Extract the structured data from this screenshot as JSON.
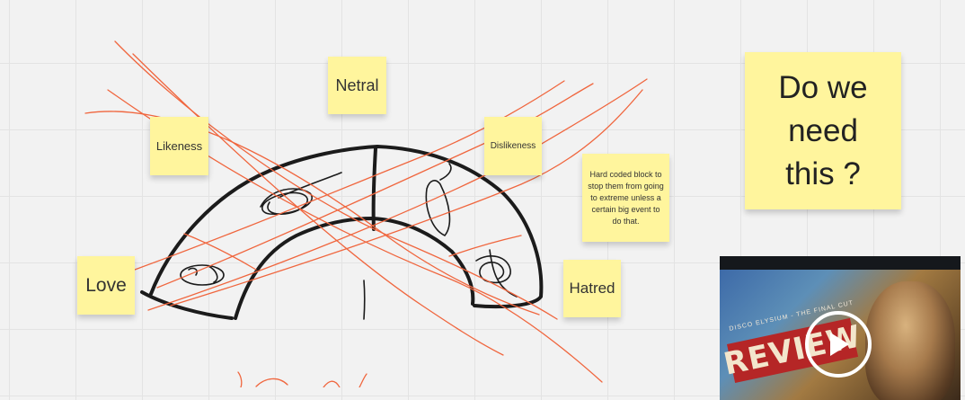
{
  "stickies": {
    "netral": "Netral",
    "likeness": "Likeness",
    "dislikeness": "Dislikeness",
    "love": "Love",
    "hatred": "Hatred",
    "hard_coded": "Hard coded block to stop them from going to extreme unless a certain big event to do that.",
    "question": "Do we need this ?"
  },
  "video": {
    "title": "DISCO ELYSIUM - THE FINAL CUT",
    "banner": "REVIEW",
    "play_icon": "play-icon"
  },
  "colors": {
    "sticky": "#fff59d",
    "ink_black": "#1b1b1b",
    "ink_red": "#f0663e",
    "canvas": "#f2f2f2"
  }
}
